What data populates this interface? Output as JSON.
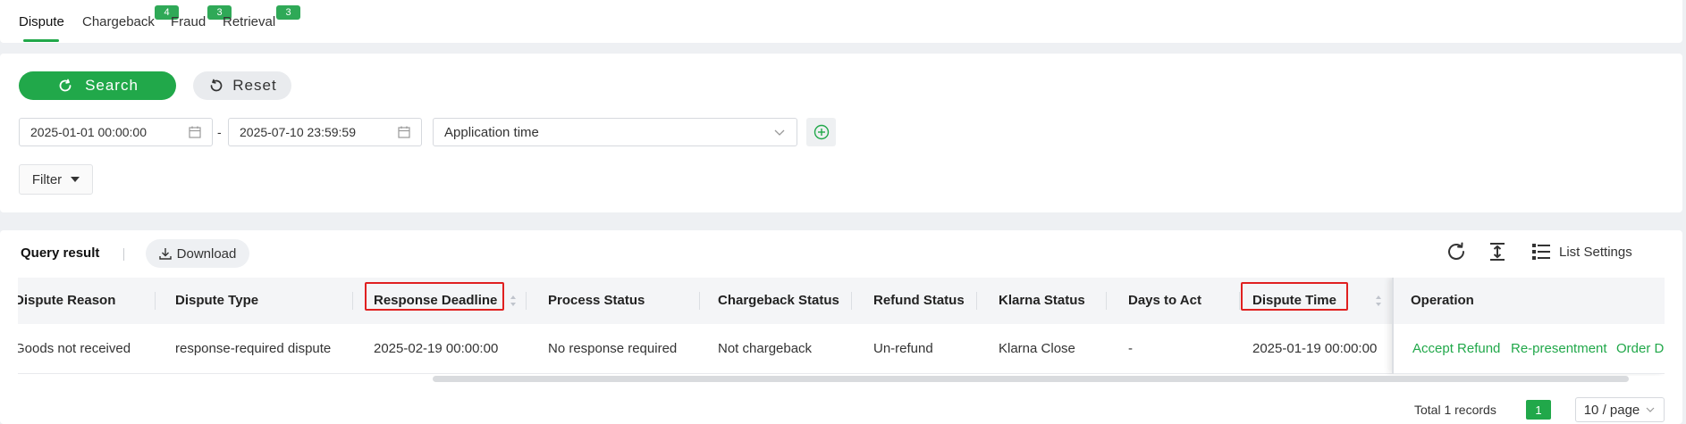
{
  "tabs": [
    {
      "label": "Dispute",
      "badge": ""
    },
    {
      "label": "Chargeback",
      "badge": "4"
    },
    {
      "label": "Fraud",
      "badge": "3"
    },
    {
      "label": "Retrieval",
      "badge": "3"
    }
  ],
  "search": {
    "search_label": "Search",
    "reset_label": "Reset",
    "date_start": "2025-01-01 00:00:00",
    "date_end": "2025-07-10 23:59:59",
    "date_separator": "-",
    "time_type": "Application time",
    "filter_label": "Filter"
  },
  "result": {
    "title": "Query result",
    "download_label": "Download",
    "list_settings_label": "List Settings",
    "columns": [
      "Dispute Reason",
      "Dispute Type",
      "Response Deadline",
      "Process Status",
      "Chargeback Status",
      "Refund Status",
      "Klarna Status",
      "Days to Act",
      "Dispute Time",
      "Operation"
    ],
    "rows": [
      {
        "dispute_reason": "Goods not received",
        "dispute_type": "response-required dispute",
        "response_deadline": "2025-02-19 00:00:00",
        "process_status": "No response required",
        "chargeback_status": "Not chargeback",
        "refund_status": "Un-refund",
        "klarna_status": "Klarna Close",
        "days_to_act": "-",
        "dispute_time": "2025-01-19 00:00:00",
        "operations": [
          "Accept Refund",
          "Re-presentment",
          "Order D"
        ]
      }
    ]
  },
  "pagination": {
    "total_text": "Total 1 records",
    "current_page": "1",
    "page_size": "10 / page"
  },
  "colors": {
    "accent": "#21a84a",
    "highlight": "#e02020"
  }
}
